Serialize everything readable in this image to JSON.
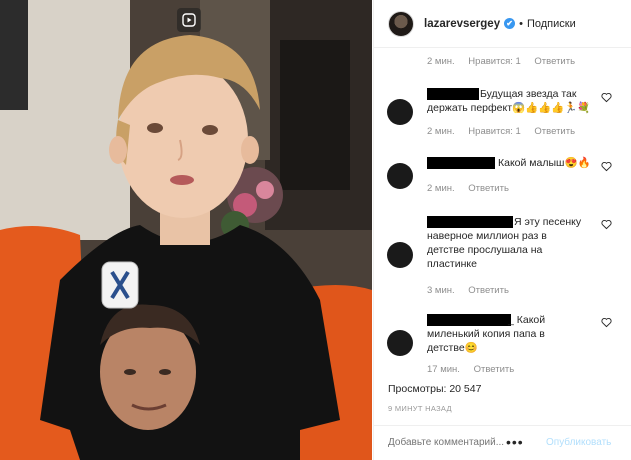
{
  "header": {
    "username": "lazarevsergey",
    "verified_mark": "✔",
    "separator": "•",
    "follow_label": "Подписки"
  },
  "comments": [
    {
      "text": "",
      "time": "2 мин.",
      "likes": "Нравится: 1",
      "reply": "Ответить"
    },
    {
      "lines": [
        "Будущая звезда так",
        "держать перфект😱👍👍👍🏃💐"
      ],
      "time": "2 мин.",
      "likes": "Нравится: 1",
      "reply": "Ответить"
    },
    {
      "text": "Какой малыш😍🔥",
      "time": "2 мин.",
      "reply": "Ответить"
    },
    {
      "lines": [
        "Я эту песенку",
        "наверное миллион раз в",
        "детстве прослушала на",
        "пластинке"
      ],
      "time": "3 мин.",
      "reply": "Ответить"
    },
    {
      "lines": [
        "_ Какой",
        "миленький копия папа в",
        "детстве😊"
      ],
      "time": "17 мин.",
      "reply": "Ответить"
    }
  ],
  "views": "Просмотры: 20 547",
  "time_ago": "9 МИНУТ НАЗАД",
  "add_comment": {
    "placeholder": "Добавьте комментарий...",
    "more": "•••",
    "post_label": "Опубликовать"
  },
  "icons": {
    "video": "video-camera-icon",
    "heart": "heart-icon"
  },
  "colors": {
    "link_blue": "#3897f0",
    "post_disabled": "#b2dffc",
    "muted_text": "#8e8e8e",
    "sofa_orange": "#e45a1d"
  }
}
